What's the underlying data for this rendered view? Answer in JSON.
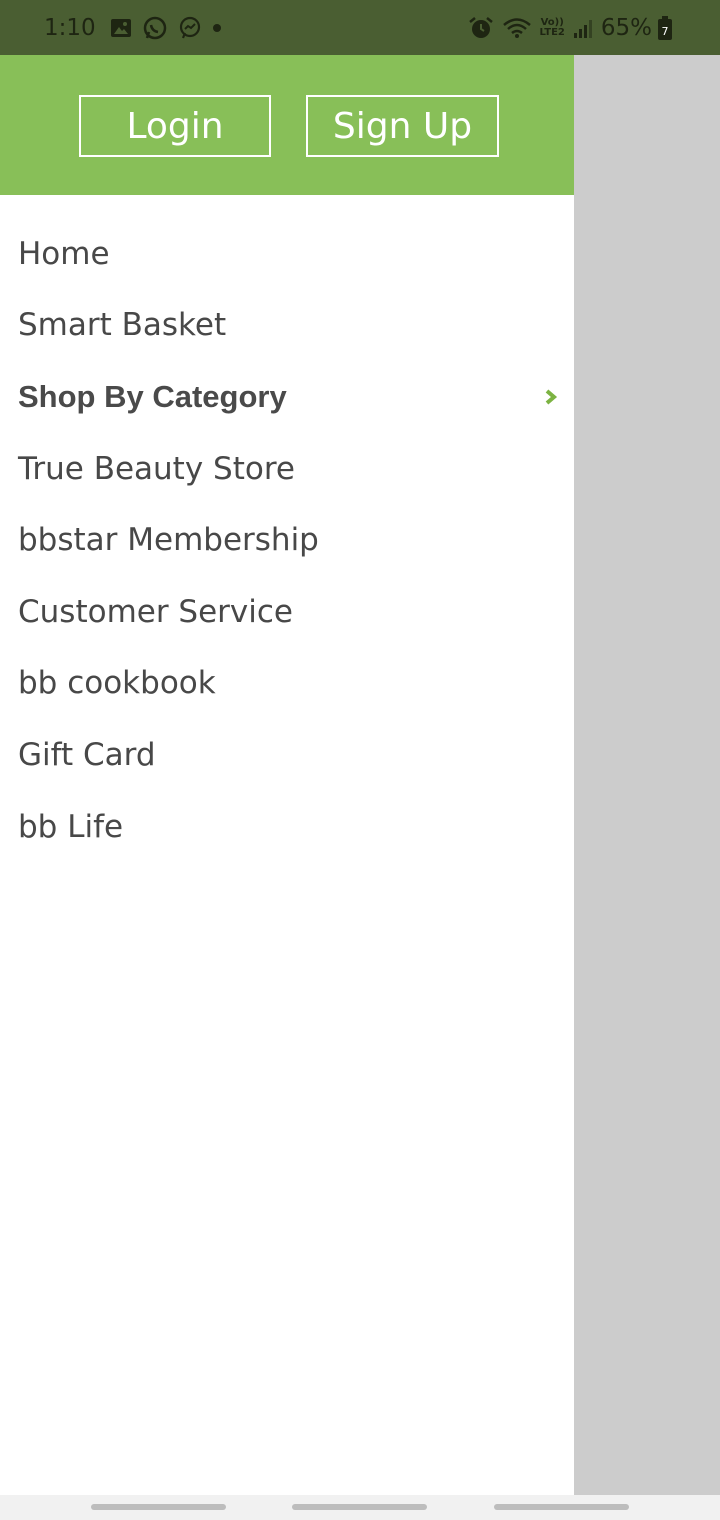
{
  "status_bar": {
    "time": "1:10",
    "battery_percent": "65%",
    "battery_level_text": "7",
    "network_label_top": "Vo))",
    "network_label_bottom": "LTE2",
    "icons_left": [
      "gallery-icon",
      "whatsapp-icon",
      "messenger-icon",
      "dot-icon"
    ],
    "icons_right": [
      "alarm-icon",
      "wifi-icon",
      "signal-icon",
      "battery-icon"
    ]
  },
  "drawer": {
    "header": {
      "login_label": "Login",
      "signup_label": "Sign Up",
      "background_color": "#88bf58"
    },
    "menu": [
      {
        "label": "Home"
      },
      {
        "label": "Smart Basket"
      },
      {
        "label": "Shop By Category",
        "bold": true,
        "has_chevron": true
      },
      {
        "label": "True Beauty Store"
      },
      {
        "label": "bbstar Membership"
      },
      {
        "label": "Customer Service"
      },
      {
        "label": "bb cookbook"
      },
      {
        "label": "Gift Card"
      },
      {
        "label": "bb Life"
      }
    ],
    "accent_color": "#7cb342"
  },
  "scrim_color": "#cccccc"
}
